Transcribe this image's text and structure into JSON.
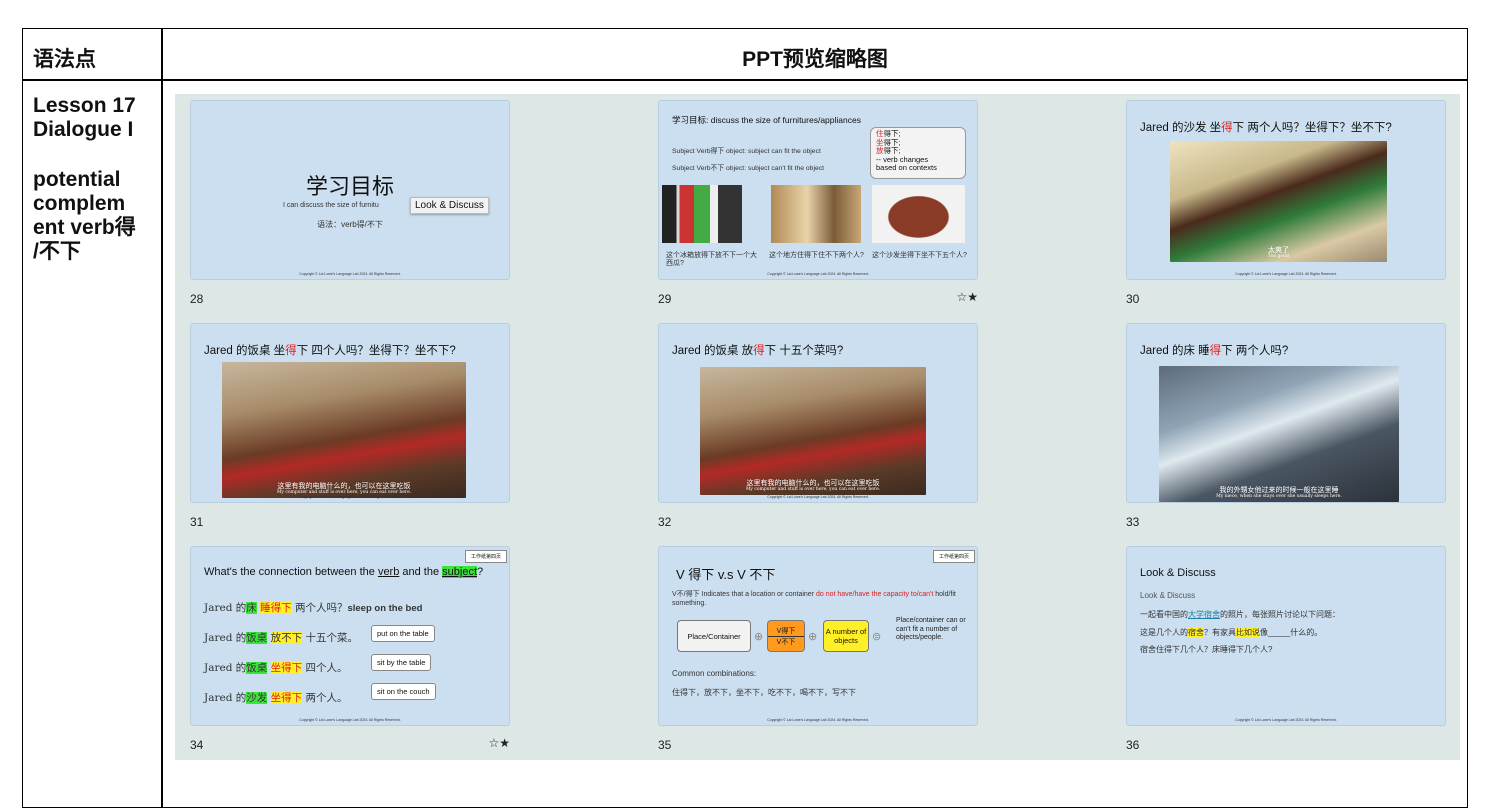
{
  "table": {
    "col1_header": "语法点",
    "col2_header": "PPT预览缩略图",
    "lesson_lines": [
      "Lesson 17",
      "Dialogue I"
    ],
    "topic_lines": [
      "potential",
      "complem",
      "ent verb得",
      "/不下"
    ]
  },
  "copyright": "Copyright © Lai Lowe's Language Lab 2024. All Rights Reserved.",
  "colors": {
    "slide_bg": "#cbdff0",
    "panel_bg": "#dde7e6",
    "accent_red": "#e21b1b",
    "highlight_green": "#3de23d",
    "highlight_yellow": "#ffef26"
  },
  "slides": {
    "s28": {
      "number": "28",
      "title": "学习目标",
      "line1": "I can discuss the size of furnitu",
      "line2": "语法：verb得/不下",
      "tooltip": "Look & Discuss"
    },
    "s29": {
      "number": "29",
      "star": "☆★",
      "title": "学习目标: discuss the size of furnitures/appliances",
      "row1": "Subject Verb得下 object:  subject can fit the object",
      "row2": "Subject Verb不下 object:  subject can't fit the object",
      "bubble": [
        "住得下;",
        "坐得下;",
        "放得下;",
        "-- verb changes",
        "based on contexts"
      ],
      "captions": [
        "这个冰箱放得下放不下一个大西瓜?",
        "这个地方住得下住不下两个人?",
        "这个沙发坐得下坐不下五个人?"
      ]
    },
    "s30": {
      "number": "30",
      "title_pre": "Jared 的沙发 坐",
      "title_red": "得",
      "title_post": "下 两个人吗？坐得下？坐不下?",
      "cap": "太爽了",
      "cap_small": "Too good"
    },
    "s31": {
      "number": "31",
      "title_pre": "Jared 的饭桌 坐",
      "title_red": "得",
      "title_post": "下 四个人吗？坐得下？坐不下?",
      "cap": "这里有我的电脑什么的，也可以在这里吃饭",
      "cap_small": "My computer and stuff is over here, you can eat over here."
    },
    "s32": {
      "number": "32",
      "title_pre": "Jared 的饭桌 放",
      "title_red": "得",
      "title_post": "下 十五个菜吗?",
      "cap": "这里有我的电脑什么的，也可以在这里吃饭",
      "cap_small": "My computer and stuff is over here, you can eat over here."
    },
    "s33": {
      "number": "33",
      "title_pre": "Jared 的床 睡",
      "title_red": "得",
      "title_post": "下 两个人吗?",
      "cap": "我的外甥女他过来的时候一般在这里睡",
      "cap_small": "My niece, when she stays over she usually sleeps here."
    },
    "s34": {
      "number": "34",
      "star": "☆★",
      "sheet": "工作纸第四页",
      "q_pre": "What's the connection between the ",
      "q_verb": "verb",
      "q_mid": " and the ",
      "q_subj": "subject",
      "q_end": "?",
      "rows": [
        {
          "pre": "Jared 的",
          "n": "床",
          "v": "睡得下",
          "post": "两个人吗？",
          "eng": "sleep on the bed"
        },
        {
          "pre": "Jared 的",
          "n": "饭桌",
          "v": "放不下",
          "post": "十五个菜。",
          "eng": "put on the table"
        },
        {
          "pre": "Jared 的",
          "n": "饭桌",
          "v": "坐得下",
          "post": "四个人。",
          "eng": "sit by the table"
        },
        {
          "pre": "Jared 的",
          "n": "沙发",
          "v": "坐得下",
          "post": "两个人。",
          "eng": "sit on the couch"
        }
      ]
    },
    "s35": {
      "number": "35",
      "sheet": "工作纸第四页",
      "title": "V 得下 v.s  V 不下",
      "desc_pre": "V不/得下 Indicates that a location or container ",
      "desc_red": "do not have/have the capacity to/can't",
      "desc_post": " hold/fit something.",
      "box1": "Place/Container",
      "box2a": "V得下",
      "box2b": "V不下",
      "box3": "A number of objects",
      "result": "Place/container can or can't fit a number of objects/people.",
      "common_label": "Common combinations:",
      "common": "住得下，放不下，坐不下，吃不下，喝不下，写不下"
    },
    "s36": {
      "number": "36",
      "title": "Look & Discuss",
      "sub": "Look & Discuss",
      "l1_pre": "一起看中国的",
      "l1_link": "大学宿舍",
      "l1_post": "的照片，每张照片讨论以下问题：",
      "l2_pre": "这是几个人的",
      "l2_h1": "宿舍",
      "l2_mid": "？有家具",
      "l2_h2": "比如说",
      "l2_post": "像_____什么的。",
      "l3": "宿舍住得下几个人？床睡得下几个人?"
    }
  }
}
